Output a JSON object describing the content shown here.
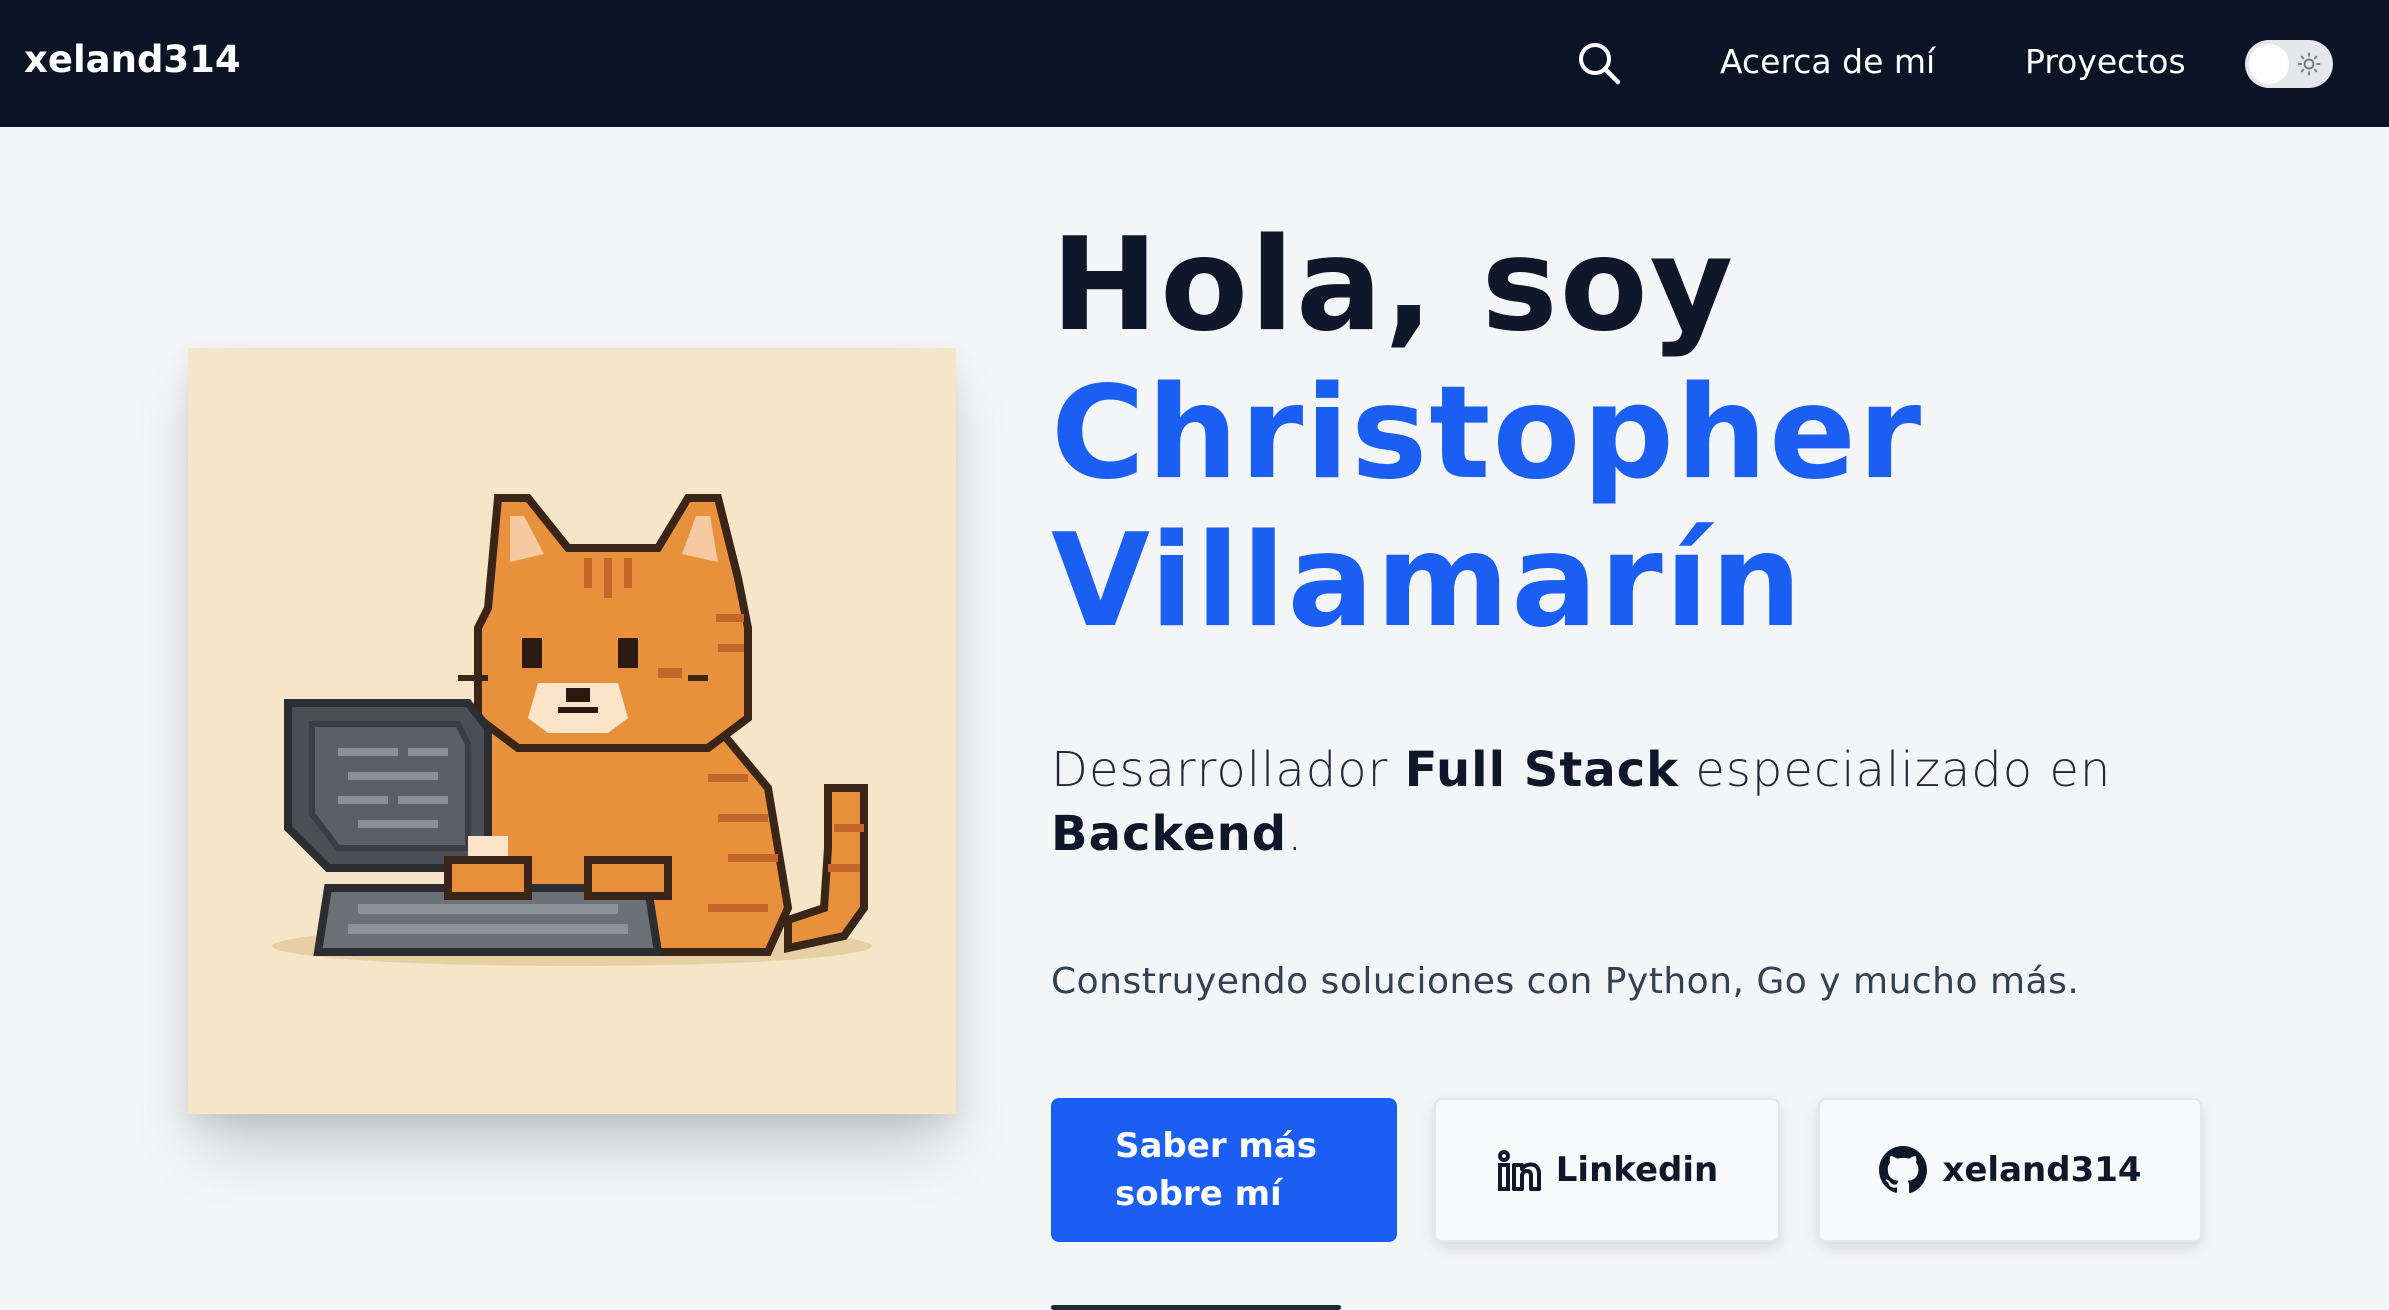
{
  "nav": {
    "brand": "xeland314",
    "search_icon": "search-icon",
    "links": [
      "Acerca de mí",
      "Proyectos"
    ],
    "theme_toggle_icon": "sun-icon",
    "background": "#0b1424"
  },
  "hero": {
    "greeting": "Hola, soy",
    "name_line1": "Christopher",
    "name_line2": "Villamarín",
    "name_color": "#1a5ef2",
    "subtitle": {
      "prefix": "Desarrollador ",
      "bold1": "Full Stack",
      "middle": " especializado en ",
      "bold2": "Backend",
      "suffix": "."
    },
    "tagline": "Construyendo soluciones con Python, Go y mucho más.",
    "avatar_icon": "pixel-cat-laptop-illustration"
  },
  "buttons": {
    "primary": "Saber más sobre mí",
    "linkedin": "Linkedin",
    "github": "xeland314",
    "primary_color": "#1a5ef2"
  }
}
